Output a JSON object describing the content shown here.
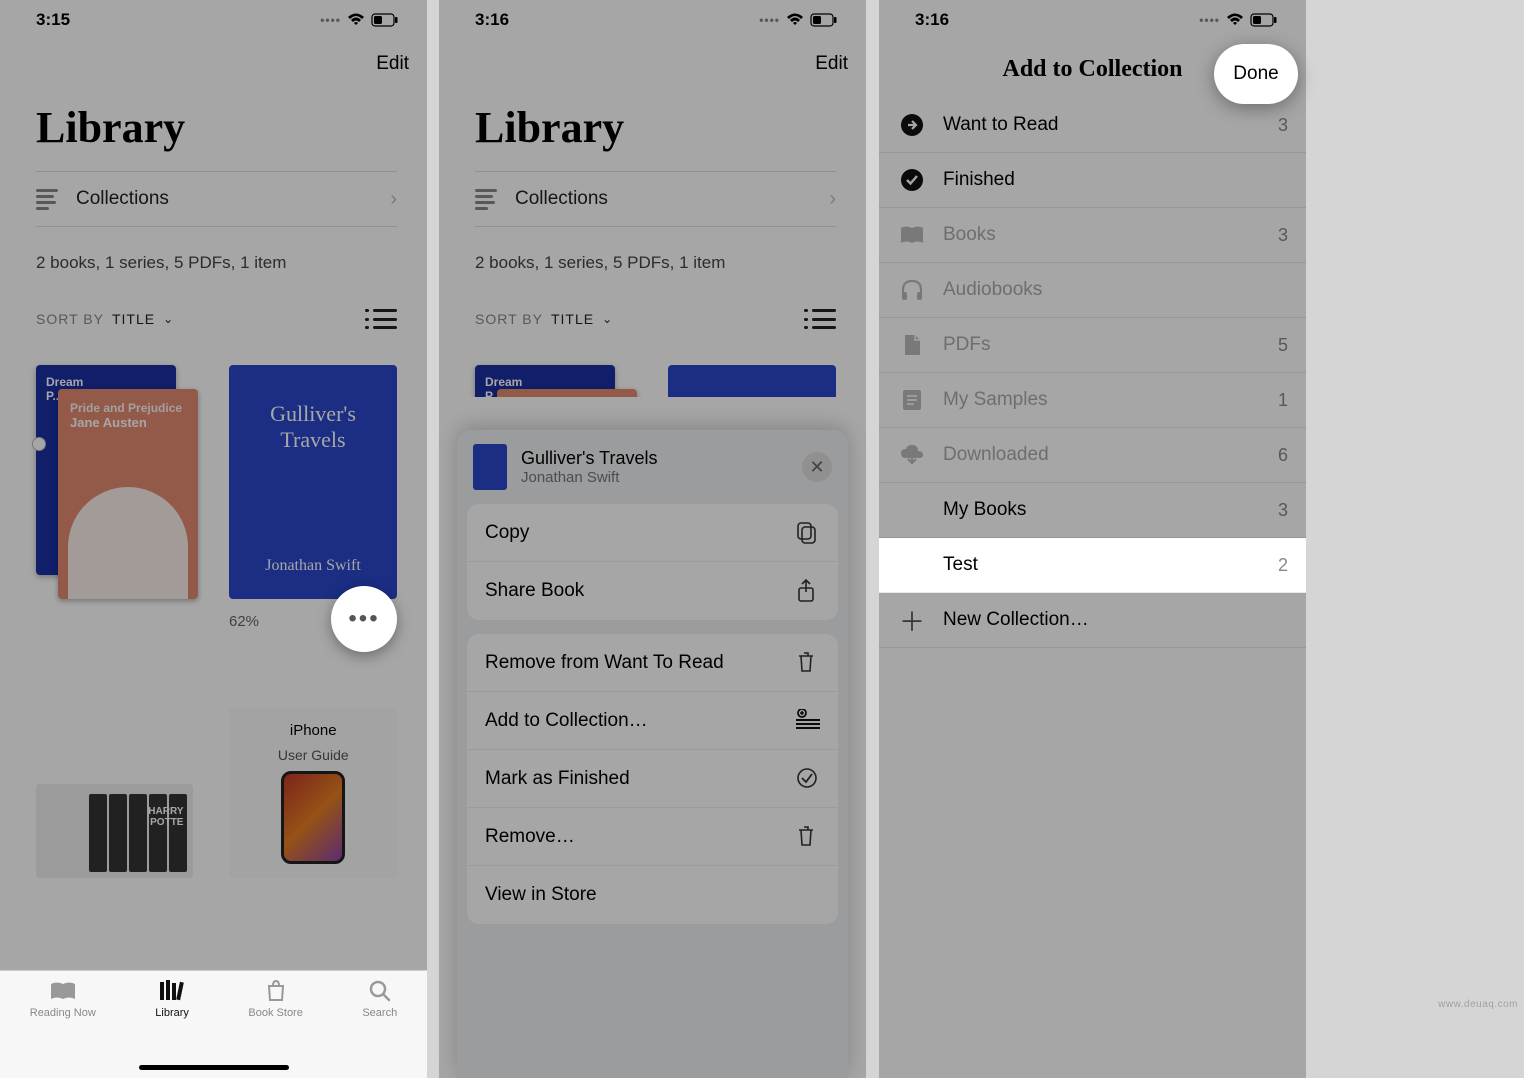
{
  "status": {
    "time1": "3:15",
    "time2": "3:16",
    "time3": "3:16"
  },
  "s1": {
    "edit": "Edit",
    "title": "Library",
    "collections": "Collections",
    "summary": "2 books, 1 series, 5 PDFs, 1 item",
    "sort_label": "SORT BY",
    "sort_value": "TITLE",
    "stack_back_title": "Dream\nP...",
    "stack_front_title": "Pride and Prejudice",
    "stack_front_author": "Jane Austen",
    "book2_title": "Gulliver's Travels",
    "book2_author": "Jonathan Swift",
    "book2_pct": "62%",
    "hp_label": "HARRY\nPOTTE",
    "guide_brand": "iPhone",
    "guide_sub": "User Guide",
    "tabs": [
      "Reading Now",
      "Library",
      "Book Store",
      "Search"
    ]
  },
  "s2": {
    "edit": "Edit",
    "title": "Library",
    "collections": "Collections",
    "summary": "2 books, 1 series, 5 PDFs, 1 item",
    "sort_label": "SORT BY",
    "sort_value": "TITLE",
    "sheet_title": "Gulliver's Travels",
    "sheet_author": "Jonathan Swift",
    "actions": {
      "copy": "Copy",
      "share": "Share Book",
      "remove_want": "Remove from Want To Read",
      "add_coll": "Add to Collection…",
      "mark_finished": "Mark as Finished",
      "remove": "Remove…",
      "view_store": "View in Store"
    }
  },
  "s3": {
    "title": "Add to Collection",
    "done": "Done",
    "rows": {
      "want": {
        "label": "Want to Read",
        "count": "3"
      },
      "finished": {
        "label": "Finished",
        "count": ""
      },
      "books": {
        "label": "Books",
        "count": "3"
      },
      "audiobooks": {
        "label": "Audiobooks",
        "count": ""
      },
      "pdfs": {
        "label": "PDFs",
        "count": "5"
      },
      "samples": {
        "label": "My Samples",
        "count": "1"
      },
      "downloaded": {
        "label": "Downloaded",
        "count": "6"
      },
      "mybooks": {
        "label": "My Books",
        "count": "3"
      },
      "test": {
        "label": "Test",
        "count": "2"
      },
      "newc": {
        "label": "New Collection…",
        "count": ""
      }
    }
  },
  "watermark": "www.deuaq.com"
}
